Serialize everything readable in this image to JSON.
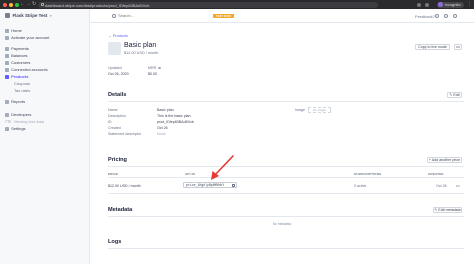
{
  "browser": {
    "url": "dashboard.stripe.com/test/products/prod_IDfep83BAd5Xvb",
    "profile_name": "Incognito"
  },
  "sidebar": {
    "account_name": "Flask Stripe Test",
    "items": [
      {
        "label": "Home",
        "icon": "home-icon"
      },
      {
        "label": "Activate your account",
        "icon": "arrow-right-icon"
      },
      {
        "label": "Payments",
        "icon": "card-icon"
      },
      {
        "label": "Balances",
        "icon": "balance-icon"
      },
      {
        "label": "Customers",
        "icon": "person-icon"
      },
      {
        "label": "Connected accounts",
        "icon": "connect-icon"
      },
      {
        "label": "Products",
        "icon": "box-icon"
      },
      {
        "label": "Coupons",
        "icon": ""
      },
      {
        "label": "Tax rates",
        "icon": ""
      },
      {
        "label": "Reports",
        "icon": "chart-icon"
      },
      {
        "label": "Developers",
        "icon": "code-icon"
      },
      {
        "label": "Viewing test data",
        "icon": "toggle-icon"
      },
      {
        "label": "Settings",
        "icon": "gear-icon"
      }
    ],
    "active": "Products"
  },
  "topbar": {
    "search_placeholder": "Search...",
    "test_badge": "TEST DATA",
    "feedback_label": "Feedback?"
  },
  "product": {
    "breadcrumb": "Products",
    "name": "Basic plan",
    "subtitle": "$12.00 USD / month",
    "copy_button": "Copy to live mode",
    "more_button": "•••",
    "updated_label": "Updated",
    "updated_value": "Oct 26, 2020",
    "mrr_label": "MRR",
    "mrr_value": "$0.00"
  },
  "details": {
    "title": "Details",
    "edit_button": "Edit",
    "rows": [
      {
        "label": "Name",
        "value": "Basic plan"
      },
      {
        "label": "Description",
        "value": "This is the basic plan."
      },
      {
        "label": "ID",
        "value": "prod_IDfep83BAd5Xvb"
      },
      {
        "label": "Created",
        "value": "Oct 26"
      },
      {
        "label": "Statement descriptor",
        "value": "None"
      }
    ],
    "image_label": "Image",
    "image_placeholder": "No image"
  },
  "pricing": {
    "title": "Pricing",
    "add_button": "+ Add another price",
    "columns": [
      "PRICE",
      "API ID",
      "SUBSCRIPTIONS",
      "CREATED"
    ],
    "rows": [
      {
        "price": "$12.00 USD / month",
        "api_id": "price_1HgblyBpNMVhbY",
        "subscriptions": "0 active",
        "created": "Oct 26",
        "more": "•••"
      }
    ]
  },
  "metadata": {
    "title": "Metadata",
    "edit_button": "Edit metadata",
    "empty": "No metadata"
  },
  "logs": {
    "title": "Logs"
  },
  "colors": {
    "accent": "#635bff",
    "arrow": "#e53935",
    "test_badge": "#f5a623"
  }
}
